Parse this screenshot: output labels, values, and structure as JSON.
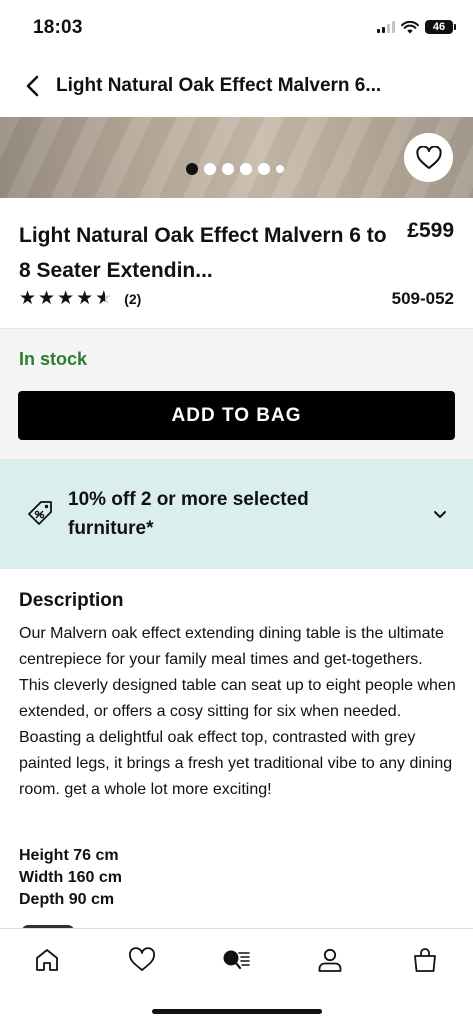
{
  "status_bar": {
    "time": "18:03",
    "battery_level": "46",
    "icons": [
      "cellular-signal-icon",
      "wifi-icon",
      "battery-icon"
    ]
  },
  "nav": {
    "title": "Light Natural Oak Effect Malvern 6...",
    "back_icon": "chevron-left-icon"
  },
  "gallery": {
    "dot_count": 6,
    "active_index": 0,
    "favourite_icon": "heart-outline-icon"
  },
  "product": {
    "title": "Light Natural Oak Effect Malvern 6 to 8 Seater Extendin...",
    "price": "£599",
    "rating": 4.5,
    "rating_max": 5,
    "review_count": "(2)",
    "sku": "509-052"
  },
  "buy": {
    "stock_status": "In stock",
    "add_to_bag_label": "ADD TO BAG",
    "stock_color": "#2e7d32"
  },
  "promo": {
    "text": "10% off 2 or more selected furniture*",
    "icon": "price-tag-icon",
    "chevron_icon": "chevron-down-icon",
    "background": "#dbeeee"
  },
  "description": {
    "heading": "Description",
    "body": "Our Malvern oak effect extending dining table is the ultimate centrepiece for your family meal times and get-togethers. This cleverly designed table can seat up to eight people when extended, or offers a cosy sitting for six when needed. Boasting a delightful oak effect top, contrasted with grey painted legs, it brings a fresh yet traditional vibe to any dining room. get a whole lot more exciting!",
    "height": "Height 76 cm",
    "width": "Width 160 cm",
    "depth": "Depth 90 cm"
  },
  "tab_bar": {
    "items": [
      {
        "name": "home",
        "icon": "home-icon"
      },
      {
        "name": "wishlist",
        "icon": "heart-icon"
      },
      {
        "name": "search",
        "icon": "search-list-icon"
      },
      {
        "name": "account",
        "icon": "person-icon"
      },
      {
        "name": "bag",
        "icon": "shopping-bag-icon"
      }
    ]
  }
}
